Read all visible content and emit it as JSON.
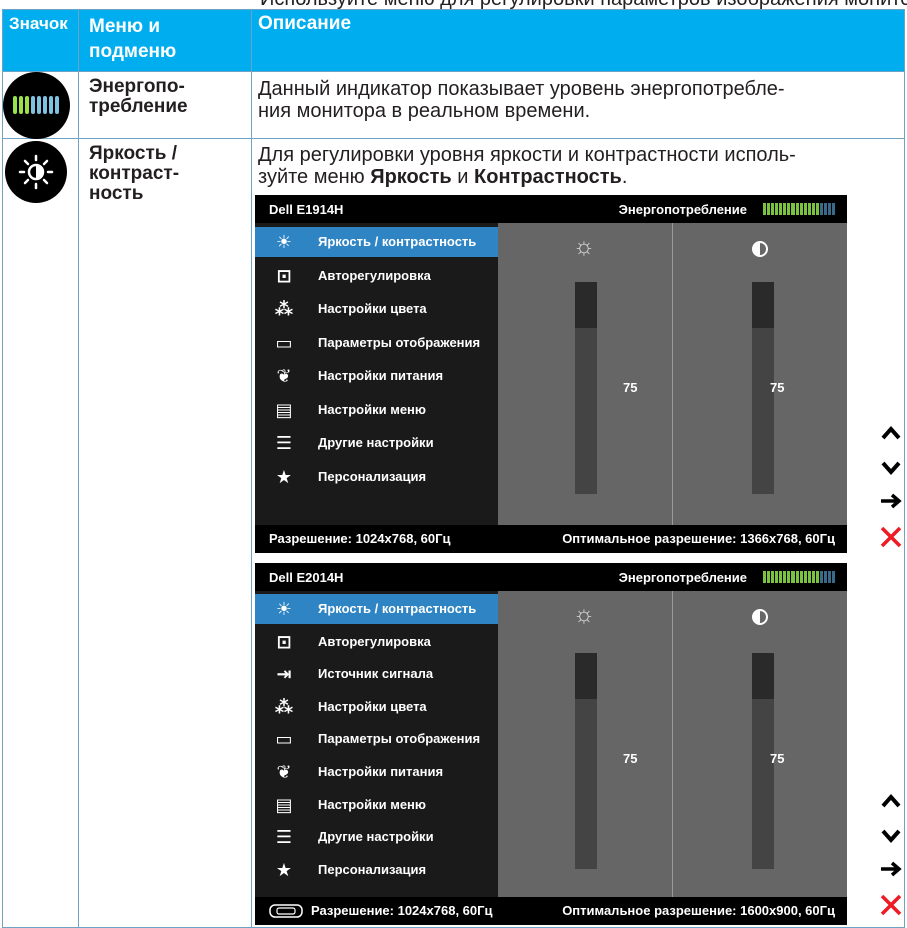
{
  "previous_page_tail": "Используйте меню для регулировки параметров изображения монитора и других функций.",
  "table": {
    "headers": [
      "Значок",
      "Меню и\nподменю",
      "Описание"
    ],
    "rows": [
      {
        "icon": "power-meter-icon",
        "menu": "Энергопо-\nтребление",
        "description": "Данный индикатор показывает уровень энергопотребле-\nния монитора в реальном времени."
      },
      {
        "icon": "brightness-icon",
        "menu": "Яркость /\nконтраст-\nность",
        "description_pre": "Для регулировки уровня яркости и контрастности исполь-\nзуйте меню ",
        "description_b1": "Яркость",
        "description_mid": " и ",
        "description_b2": "Контрастность",
        "description_post": "."
      }
    ]
  },
  "osd1": {
    "model": "Dell E1914H",
    "power_label": "Энергопотребление",
    "menu": [
      {
        "icon": "brightness-icon",
        "label": "Яркость / контрастность",
        "selected": true
      },
      {
        "icon": "auto-adjust-icon",
        "label": "Авторегулировка"
      },
      {
        "icon": "color-settings-icon",
        "label": "Настройки цвета"
      },
      {
        "icon": "display-settings-icon",
        "label": "Параметры отображения"
      },
      {
        "icon": "energy-settings-icon",
        "label": "Настройки питания"
      },
      {
        "icon": "menu-settings-icon",
        "label": "Настройки меню"
      },
      {
        "icon": "other-settings-icon",
        "label": "Другие настройки"
      },
      {
        "icon": "personalize-icon",
        "label": "Персонализация"
      }
    ],
    "brightness_value": "75",
    "contrast_value": "75",
    "resolution": "Разрешение: 1024x768, 60Гц",
    "optimal": "Оптимальное разрешение: 1366x768, 60Гц"
  },
  "osd2": {
    "model": "Dell E2014H",
    "power_label": "Энергопотребление",
    "menu": [
      {
        "icon": "brightness-icon",
        "label": "Яркость / контрастность",
        "selected": true
      },
      {
        "icon": "auto-adjust-icon",
        "label": "Авторегулировка"
      },
      {
        "icon": "input-source-icon",
        "label": "Источник сигнала"
      },
      {
        "icon": "color-settings-icon",
        "label": "Настройки цвета"
      },
      {
        "icon": "display-settings-icon",
        "label": "Параметры отображения"
      },
      {
        "icon": "energy-settings-icon",
        "label": "Настройки питания"
      },
      {
        "icon": "menu-settings-icon",
        "label": "Настройки меню"
      },
      {
        "icon": "other-settings-icon",
        "label": "Другие настройки"
      },
      {
        "icon": "personalize-icon",
        "label": "Персонализация"
      }
    ],
    "brightness_value": "75",
    "contrast_value": "75",
    "resolution": "Разрешение: 1024x768, 60Гц",
    "optimal": "Оптимальное разрешение: 1600x900, 60Гц"
  },
  "colors": {
    "header_bg": "#00aeef",
    "selected_item": "#2f85c4",
    "nav_close": "#ed1c24"
  }
}
